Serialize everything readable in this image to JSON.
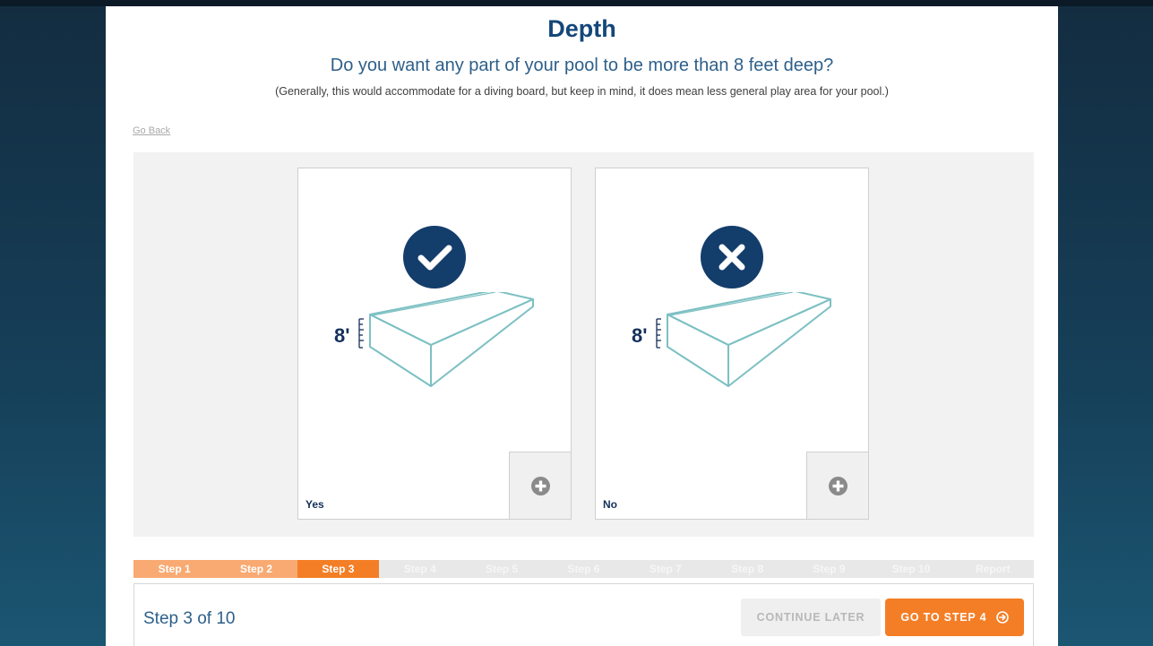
{
  "header": {
    "title": "Depth",
    "question": "Do you want any part of your pool to be more than 8 feet deep?",
    "subtext": "(Generally, this would accommodate for a diving board, but keep in mind, it does mean less general play area for your pool.)",
    "go_back": "Go Back"
  },
  "options": [
    {
      "label": "Yes",
      "icon": "check-icon",
      "depth_label": "8'"
    },
    {
      "label": "No",
      "icon": "close-icon",
      "depth_label": "8'"
    }
  ],
  "steps": {
    "items": [
      "Step 1",
      "Step 2",
      "Step 3",
      "Step 4",
      "Step 5",
      "Step 6",
      "Step 7",
      "Step 8",
      "Step 9",
      "Step 10",
      "Report"
    ],
    "current": 3
  },
  "footer": {
    "step_count": "Step 3 of 10",
    "continue_later": "CONTINUE LATER",
    "next_label": "GO TO STEP 4"
  },
  "colors": {
    "title": "#14477a",
    "badge": "#133d6b",
    "accent": "#f47e26",
    "step_done": "#f8aa72",
    "pool_outline": "#7cc0c3",
    "background": "#16405a"
  }
}
